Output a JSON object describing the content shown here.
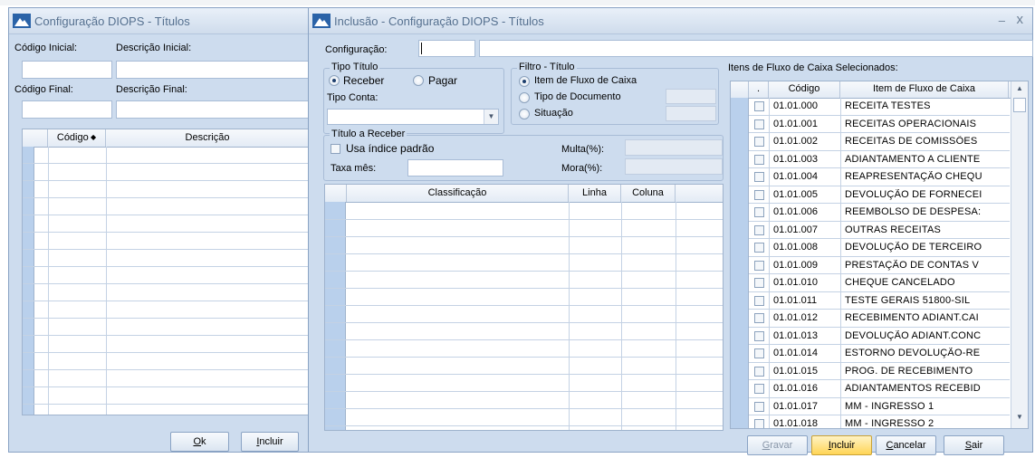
{
  "back_window": {
    "title": "Configuração DIOPS - Títulos",
    "codigo_inicial_label": "Código Inicial:",
    "descricao_inicial_label": "Descrição Inicial:",
    "codigo_final_label": "Código Final:",
    "descricao_final_label": "Descrição Final:",
    "grid_headers": {
      "codigo": "Código",
      "descricao": "Descrição"
    },
    "ok_label_accel": "O",
    "ok_label_rest": "k",
    "incluir_label_accel": "I",
    "incluir_label_rest": "ncluir"
  },
  "dialog": {
    "title": "Inclusão - Configuração DIOPS - Títulos",
    "close_glyph": "x",
    "minimize_glyph": "–",
    "configuracao_label": "Configuração:",
    "tipo_titulo": {
      "title": "Tipo Título",
      "receber": "Receber",
      "pagar": "Pagar",
      "selected": "Receber"
    },
    "tipo_conta_label": "Tipo Conta:",
    "filtro": {
      "title": "Filtro - Título",
      "item_fluxo": "Item de Fluxo de Caixa",
      "tipo_documento": "Tipo de Documento",
      "situacao": "Situação",
      "selected": "Item de Fluxo de Caixa"
    },
    "titulo_receber": {
      "title": "Título a Receber",
      "usa_indice": "Usa índice padrão",
      "multa_label": "Multa(%):",
      "taxa_label": "Taxa mês:",
      "mora_label": "Mora(%):"
    },
    "class_grid_headers": {
      "classificacao": "Classificação",
      "linha": "Linha",
      "coluna": "Coluna"
    },
    "itens_label": "Itens de Fluxo de Caixa Selecionados:",
    "itens_headers": {
      "dot": ".",
      "codigo": "Código",
      "item": "Item de Fluxo de Caixa"
    },
    "itens": [
      {
        "codigo": "01.01.000",
        "item": "RECEITA TESTES"
      },
      {
        "codigo": "01.01.001",
        "item": "RECEITAS OPERACIONAIS"
      },
      {
        "codigo": "01.01.002",
        "item": "RECEITAS DE COMISSÕES"
      },
      {
        "codigo": "01.01.003",
        "item": "ADIANTAMENTO A CLIENTE"
      },
      {
        "codigo": "01.01.004",
        "item": "REAPRESENTAÇÃO CHEQU"
      },
      {
        "codigo": "01.01.005",
        "item": "DEVOLUÇÃO DE FORNECEI"
      },
      {
        "codigo": "01.01.006",
        "item": "REEMBOLSO DE DESPESA:"
      },
      {
        "codigo": "01.01.007",
        "item": "OUTRAS RECEITAS"
      },
      {
        "codigo": "01.01.008",
        "item": "DEVOLUÇÃO DE TERCEIRO"
      },
      {
        "codigo": "01.01.009",
        "item": "PRESTAÇÃO DE CONTAS V"
      },
      {
        "codigo": "01.01.010",
        "item": "CHEQUE CANCELADO"
      },
      {
        "codigo": "01.01.011",
        "item": "TESTE GERAIS 51800-SIL"
      },
      {
        "codigo": "01.01.012",
        "item": "RECEBIMENTO ADIANT.CAI"
      },
      {
        "codigo": "01.01.013",
        "item": "DEVOLUÇÃO ADIANT.CONC"
      },
      {
        "codigo": "01.01.014",
        "item": "ESTORNO DEVOLUÇÃO-RE"
      },
      {
        "codigo": "01.01.015",
        "item": "PROG. DE RECEBIMENTO"
      },
      {
        "codigo": "01.01.016",
        "item": "ADIANTAMENTOS RECEBID"
      },
      {
        "codigo": "01.01.017",
        "item": "MM - INGRESSO 1"
      },
      {
        "codigo": "01.01.018",
        "item": "MM - INGRESSO 2"
      }
    ],
    "buttons": {
      "gravar": {
        "accel": "G",
        "rest": "ravar"
      },
      "incluir": {
        "accel": "I",
        "rest": "ncluir"
      },
      "cancelar": {
        "accel": "C",
        "rest": "ancelar"
      },
      "sair": {
        "accel": "S",
        "rest": "air"
      }
    }
  }
}
